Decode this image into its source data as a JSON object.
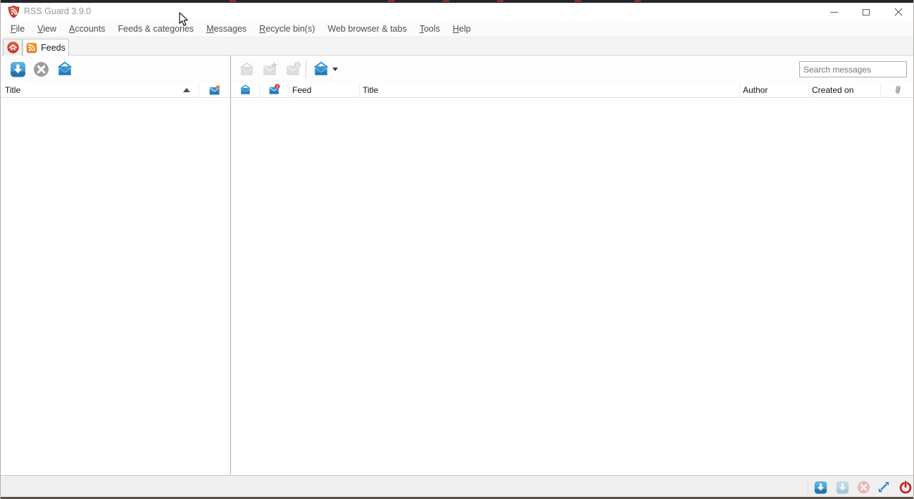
{
  "window": {
    "title": "RSS Guard 3.9.0",
    "controls": [
      {
        "name": "minimize",
        "icon": "minimize-icon"
      },
      {
        "name": "maximize",
        "icon": "maximize-icon"
      },
      {
        "name": "close",
        "icon": "close-icon"
      }
    ]
  },
  "menubar": {
    "items": [
      {
        "label": "File"
      },
      {
        "label": "View"
      },
      {
        "label": "Accounts"
      },
      {
        "label": "Feeds & categories"
      },
      {
        "label": "Messages"
      },
      {
        "label": "Recycle bin(s)"
      },
      {
        "label": "Web browser & tabs"
      },
      {
        "label": "Tools"
      },
      {
        "label": "Help"
      }
    ]
  },
  "tabs": {
    "home": {
      "icon": "home-icon"
    },
    "feeds": {
      "label": "Feeds",
      "icon": "rss-icon",
      "active": true
    }
  },
  "feeds_toolbar": {
    "buttons": [
      {
        "name": "update-all-feeds",
        "icon": "download-icon",
        "enabled": true
      },
      {
        "name": "stop-running-update",
        "icon": "cancel-icon",
        "enabled": true
      },
      {
        "name": "mark-all-read",
        "icon": "envelope-open-blue-icon",
        "enabled": true
      }
    ]
  },
  "messages_toolbar": {
    "buttons": [
      {
        "name": "mark-read",
        "icon": "envelope-open-gray-icon",
        "enabled": false
      },
      {
        "name": "mark-starred",
        "icon": "envelope-star-gray-icon",
        "enabled": false
      },
      {
        "name": "mark-important",
        "icon": "envelope-exclamation-gray-icon",
        "enabled": false
      },
      {
        "name": "mark-selection-read",
        "icon": "envelope-open-blue-icon",
        "enabled": true,
        "has_dropdown": true
      }
    ],
    "search": {
      "placeholder": "Search messages",
      "value": ""
    }
  },
  "feed_list": {
    "columns": [
      {
        "label": "Title",
        "sorted": "ascending"
      },
      {
        "icon": "envelope-star-blue-icon"
      }
    ],
    "rows": []
  },
  "message_list": {
    "columns": [
      {
        "icon": "envelope-open-blue-icon"
      },
      {
        "icon": "envelope-exclamation-red-icon"
      },
      {
        "label": "Feed"
      },
      {
        "label": "Title"
      },
      {
        "label": "Author"
      },
      {
        "label": "Created on"
      },
      {
        "icon": "attachment-icon"
      }
    ],
    "rows": []
  },
  "statusbar": {
    "buttons": [
      {
        "name": "update-all-items",
        "icon": "download-icon",
        "enabled": true
      },
      {
        "name": "update-selected-items",
        "icon": "download-icon",
        "enabled": false
      },
      {
        "name": "stop-update",
        "icon": "cancel-icon",
        "enabled": false
      },
      {
        "name": "toggle-fullscreen",
        "icon": "fullscreen-arrows-icon",
        "enabled": true
      },
      {
        "name": "quit-application",
        "icon": "power-icon",
        "enabled": true
      }
    ]
  },
  "colors": {
    "accent_blue": "#2f8fd2",
    "rss_orange": "#ec8418",
    "disabled_gray": "#a6a6a6",
    "power_red": "#c1201b",
    "badge_red": "#d93025",
    "star_orange": "#f07d1a"
  }
}
